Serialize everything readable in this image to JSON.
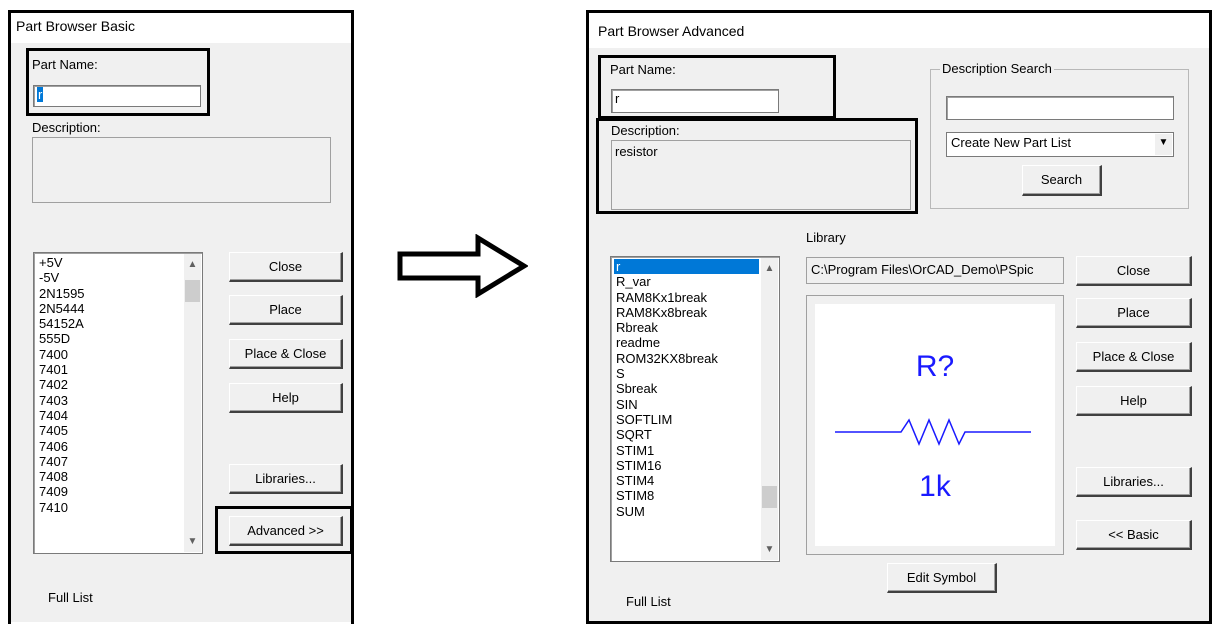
{
  "basic": {
    "title": "Part Browser Basic",
    "part_name_label": "Part Name:",
    "part_name_value": "r",
    "description_label": "Description:",
    "description_value": "",
    "list_items": [
      "+5V",
      "-5V",
      "2N1595",
      "2N5444",
      "54152A",
      "555D",
      "7400",
      "7401",
      "7402",
      "7403",
      "7404",
      "7405",
      "7406",
      "7407",
      "7408",
      "7409",
      "7410"
    ],
    "buttons": {
      "close": "Close",
      "place": "Place",
      "place_close": "Place & Close",
      "help": "Help",
      "libraries": "Libraries...",
      "advanced": "Advanced >>"
    },
    "footer": "Full List"
  },
  "advanced": {
    "title": "Part Browser Advanced",
    "part_name_label": "Part Name:",
    "part_name_value": "r",
    "description_label": "Description:",
    "description_value": "resistor",
    "description_search": {
      "label": "Description Search",
      "input_value": "",
      "select_value": "Create New Part List",
      "search_button": "Search"
    },
    "library_label": "Library",
    "library_path": "C:\\Program Files\\OrCAD_Demo\\PSpic",
    "list_items": [
      "r",
      "R_var",
      "RAM8Kx1break",
      "RAM8Kx8break",
      "Rbreak",
      "readme",
      "ROM32KX8break",
      "S",
      "Sbreak",
      "SIN",
      "SOFTLIM",
      "SQRT",
      "STIM1",
      "STIM16",
      "STIM4",
      "STIM8",
      "SUM"
    ],
    "selected_item": "r",
    "preview": {
      "ref": "R?",
      "value": "1k",
      "color": "#1a1aff"
    },
    "buttons": {
      "close": "Close",
      "place": "Place",
      "place_close": "Place & Close",
      "help": "Help",
      "libraries": "Libraries...",
      "basic": "<< Basic",
      "edit_symbol": "Edit Symbol"
    },
    "footer": "Full List"
  }
}
